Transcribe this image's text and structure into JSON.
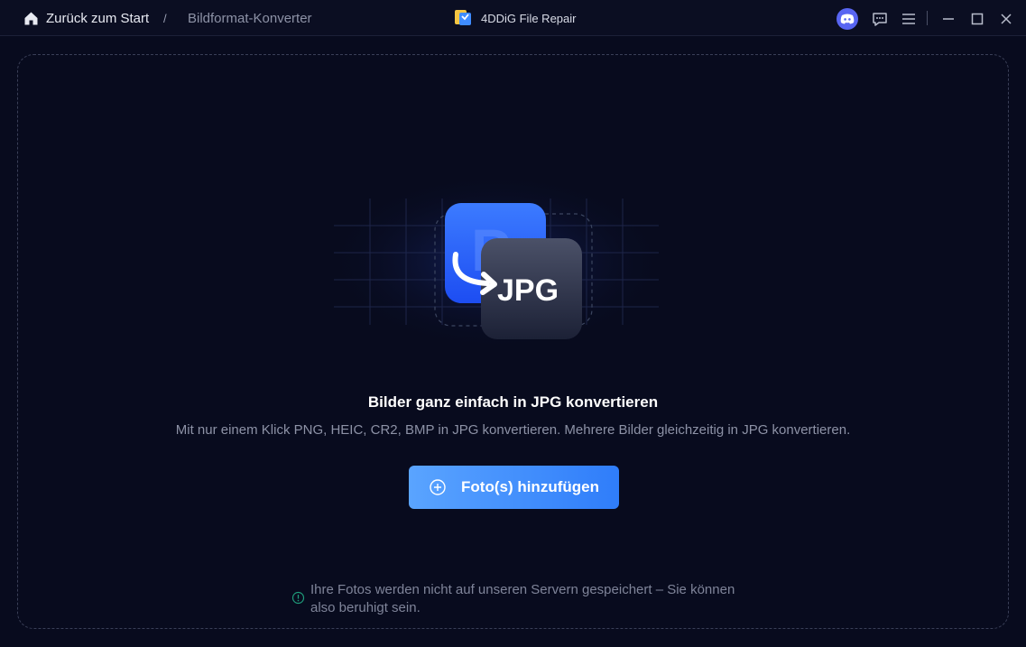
{
  "titlebar": {
    "back_label": "Zurück zum Start",
    "separator": "/",
    "current_page": "Bildformat-Konverter",
    "app_name": "4DDiG File Repair",
    "icons": [
      "home-icon",
      "app-logo-icon",
      "discord-icon",
      "feedback-icon",
      "menu-icon",
      "minimize-icon",
      "maximize-icon",
      "close-icon"
    ]
  },
  "hero": {
    "badge_text": "JPG",
    "source_letter": "P"
  },
  "main": {
    "heading": "Bilder ganz einfach in JPG konvertieren",
    "subheading": "Mit nur einem Klick PNG, HEIC, CR2, BMP in JPG konvertieren. Mehrere Bilder gleichzeitig in JPG konvertieren.",
    "add_button_label": "Foto(s) hinzufügen"
  },
  "footer": {
    "notice": "Ihre Fotos werden nicht auf unseren Servern gespeichert – Sie können also beruhigt sein."
  },
  "colors": {
    "background": "#080b1e",
    "accent": "#2f7dfa",
    "notice_icon": "#1f9b7a"
  }
}
